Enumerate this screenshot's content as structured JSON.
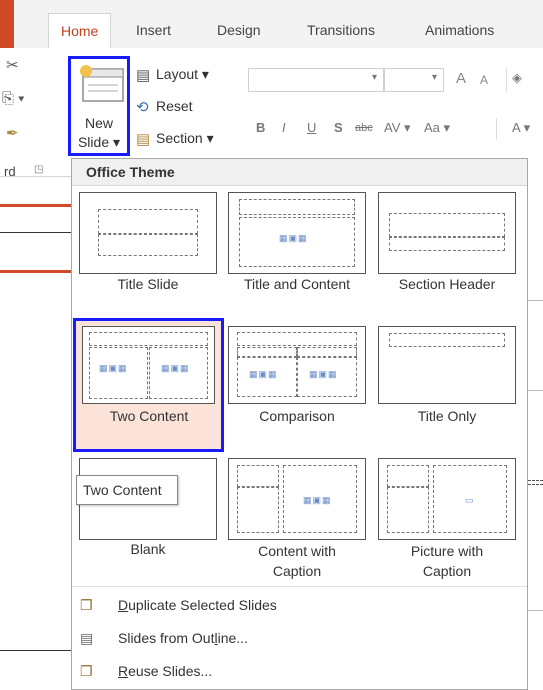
{
  "tabs": [
    "Home",
    "Insert",
    "Design",
    "Transitions",
    "Animations"
  ],
  "ribbon": {
    "new_slide": [
      "New",
      "Slide ▾"
    ],
    "layout": "Layout ▾",
    "reset": "Reset",
    "section": "Section ▾",
    "clipboard_group": "rd",
    "font_grow": "A",
    "font_shrink": "A",
    "format": [
      "B",
      "I",
      "U",
      "S",
      "abc",
      "AV ▾",
      "Aa ▾",
      "A ▾"
    ]
  },
  "menu": {
    "header": "Office Theme",
    "layouts": [
      "Title Slide",
      "Title and Content",
      "Section Header",
      "Two Content",
      "Comparison",
      "Title Only",
      "Blank",
      "Content with Caption",
      "Picture with Caption"
    ],
    "caption_lines": {
      "content_with_caption": [
        "Content with",
        "Caption"
      ],
      "picture_with_caption": [
        "Picture with",
        "Caption"
      ]
    },
    "tooltip": "Two Content",
    "items": [
      {
        "prefix": "",
        "underline": "D",
        "rest": "uplicate Selected Slides"
      },
      {
        "prefix": "Slides from Out",
        "underline": "l",
        "rest": "ine..."
      },
      {
        "prefix": "",
        "underline": "R",
        "rest": "euse Slides..."
      }
    ]
  },
  "colors": {
    "accent": "#c43e1c",
    "selection_border": "#1a1aff",
    "selection_fill": "#fbe3da"
  },
  "icons": {
    "menu_items": [
      "duplicate-slide-icon",
      "slides-from-outline-icon",
      "reuse-slides-icon"
    ]
  }
}
